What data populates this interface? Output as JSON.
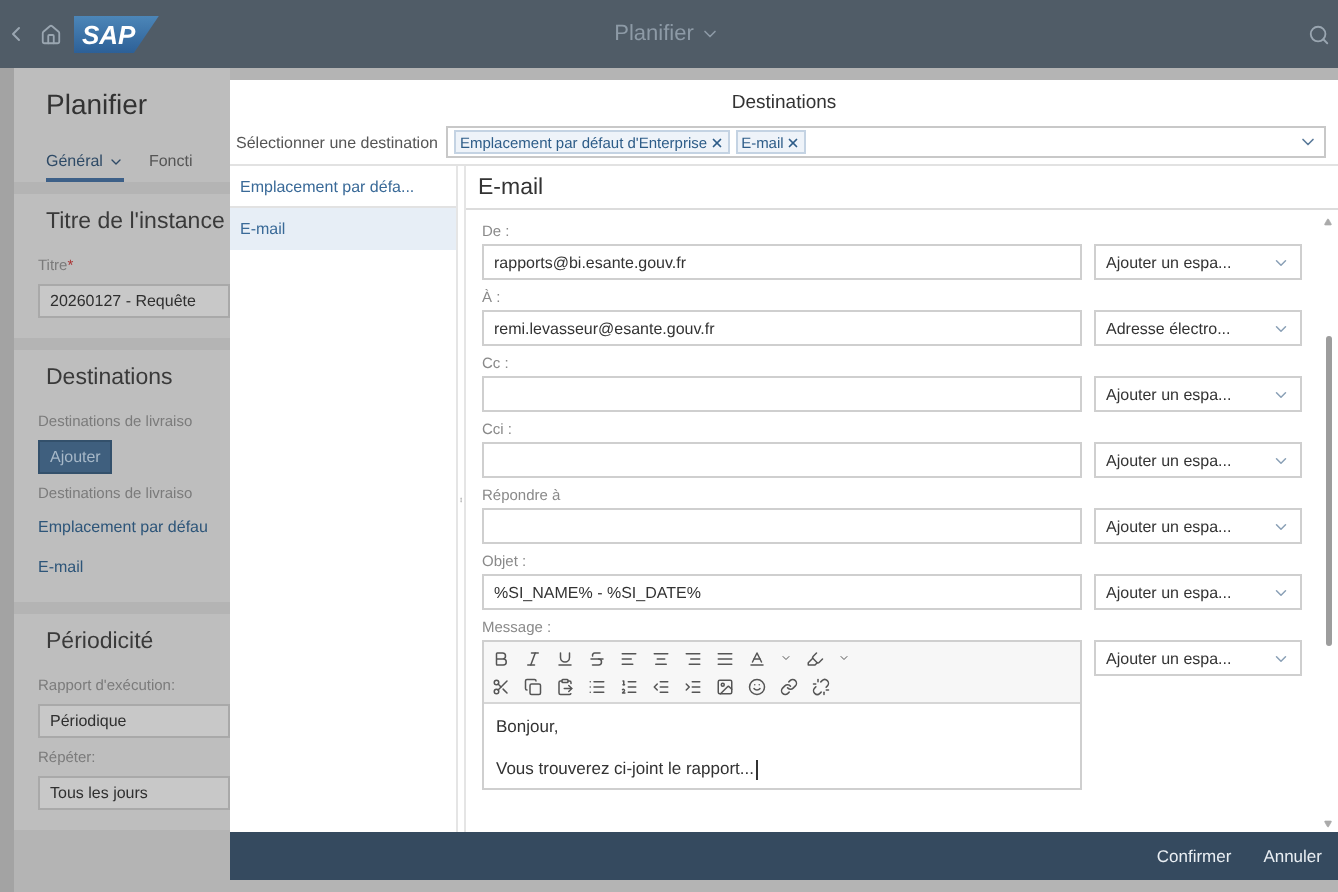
{
  "shell": {
    "logo": "SAP",
    "title": "Planifier"
  },
  "page": {
    "title": "Planifier",
    "tabs": [
      {
        "label": "Général",
        "selected": true
      },
      {
        "label": "Foncti",
        "selected": false
      }
    ],
    "title_section": {
      "heading": "Titre de l'instance",
      "label": "Titre",
      "required_mark": "*",
      "value": "20260127 - Requête"
    },
    "destinations_section": {
      "heading": "Destinations",
      "label_1": "Destinations de livraiso",
      "button": "Ajouter",
      "label_2": "Destinations de livraiso",
      "links": [
        "Emplacement par défau",
        "E-mail"
      ]
    },
    "periodicity_section": {
      "heading": "Périodicité",
      "fields": [
        {
          "label": "Rapport d'exécution:",
          "value": "Périodique"
        },
        {
          "label": "Répéter:",
          "value": "Tous les jours"
        }
      ]
    }
  },
  "dialog": {
    "title": "Destinations",
    "selector": {
      "label": "Sélectionner une destination",
      "tokens": [
        "Emplacement par défaut d'Enterprise",
        "E-mail"
      ]
    },
    "list": [
      {
        "label": "Emplacement par défa...",
        "selected": false
      },
      {
        "label": "E-mail",
        "selected": true
      }
    ],
    "panel": {
      "title": "E-mail",
      "fields": [
        {
          "kind": "input",
          "label": "De :",
          "value": "rapports@bi.esante.gouv.fr",
          "option": "Ajouter un espa..."
        },
        {
          "kind": "input",
          "label": "À :",
          "value": "remi.levasseur@esante.gouv.fr",
          "option": "Adresse électro..."
        },
        {
          "kind": "input",
          "label": "Cc :",
          "option": "Ajouter un espa..."
        },
        {
          "kind": "input",
          "label": "Cci :",
          "option": "Ajouter un espa..."
        },
        {
          "kind": "input",
          "label": "Répondre à",
          "option": "Ajouter un espa..."
        },
        {
          "kind": "input",
          "label": "Objet :",
          "value": "%SI_NAME% - %SI_DATE%",
          "option": "Ajouter un espa..."
        },
        {
          "kind": "editor",
          "label": "Message :",
          "lines": [
            "Bonjour,",
            "Vous trouverez ci-joint le rapport..."
          ],
          "option": "Ajouter un espa..."
        }
      ]
    },
    "buttons": [
      {
        "label": "Confirmer"
      },
      {
        "label": "Annuler"
      }
    ]
  }
}
